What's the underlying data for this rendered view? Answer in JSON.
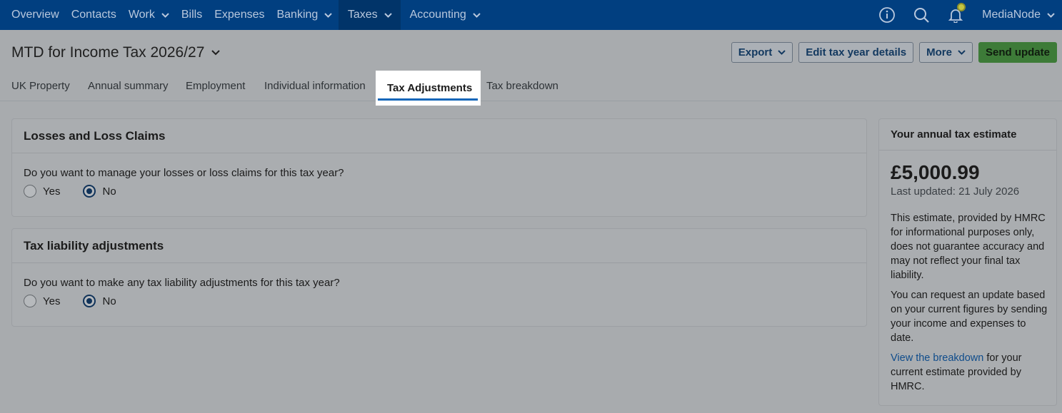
{
  "nav": {
    "items": [
      {
        "label": "Overview",
        "has_menu": false,
        "active": false
      },
      {
        "label": "Contacts",
        "has_menu": false,
        "active": false
      },
      {
        "label": "Work",
        "has_menu": true,
        "active": false
      },
      {
        "label": "Bills",
        "has_menu": false,
        "active": false
      },
      {
        "label": "Expenses",
        "has_menu": false,
        "active": false
      },
      {
        "label": "Banking",
        "has_menu": true,
        "active": false
      },
      {
        "label": "Taxes",
        "has_menu": true,
        "active": true
      },
      {
        "label": "Accounting",
        "has_menu": true,
        "active": false
      }
    ],
    "icons": [
      "info-icon",
      "search-icon",
      "bell-icon"
    ],
    "user": "MediaNode"
  },
  "page": {
    "title": "MTD for Income Tax 2026/27"
  },
  "actions": {
    "export": "Export",
    "edit": "Edit tax year details",
    "more": "More",
    "send": "Send update"
  },
  "tabs": [
    {
      "label": "UK Property",
      "active": false
    },
    {
      "label": "Annual summary",
      "active": false
    },
    {
      "label": "Employment",
      "active": false
    },
    {
      "label": "Individual information",
      "active": false
    },
    {
      "label": "Tax Adjustments",
      "active": true
    },
    {
      "label": "Tax breakdown",
      "active": false
    }
  ],
  "losses": {
    "title": "Losses and Loss Claims",
    "question": "Do you want to manage your losses or loss claims for this tax year?",
    "yes": "Yes",
    "no": "No",
    "selected": "No"
  },
  "liability": {
    "title": "Tax liability adjustments",
    "question": "Do you want to make any tax liability adjustments for this tax year?",
    "yes": "Yes",
    "no": "No",
    "selected": "No"
  },
  "estimate": {
    "title": "Your annual tax estimate",
    "amount": "£5,000.99",
    "updated": "Last updated: 21 July 2026",
    "disclaimer": "This estimate, provided by HMRC for informational purposes only, does not guarantee accuracy and may not reflect your final tax liability.",
    "request": "You can request an update based on your current figures by sending your income and expenses to date.",
    "link": "View the breakdown",
    "link_suffix": " for your current estimate provided by HMRC."
  },
  "colors": {
    "nav_bg": "#013f80",
    "accent": "#1266b9",
    "primary_button": "#3d7b38"
  }
}
